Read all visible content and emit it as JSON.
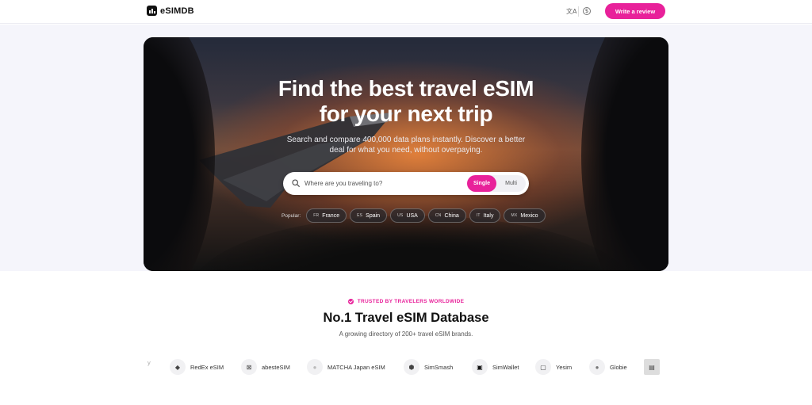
{
  "header": {
    "logo_text": "eSIMDB",
    "translate_icon": "translate-icon",
    "currency_icon": "currency-icon",
    "review_button": "Write a review"
  },
  "hero": {
    "title_line1": "Find the best travel eSIM",
    "title_line2": "for your next trip",
    "subtitle_line1": "Search and compare 400,000 data plans instantly. Discover a better",
    "subtitle_line2": "deal for what you need, without overpaying.",
    "search": {
      "placeholder": "Where are you traveling to?",
      "value": "",
      "mode_single": "Single",
      "mode_multi": "Multi",
      "active_mode": "Single"
    },
    "popular": {
      "label": "Popular:",
      "destinations": [
        {
          "code": "FR",
          "name": "France"
        },
        {
          "code": "ES",
          "name": "Spain"
        },
        {
          "code": "US",
          "name": "USA"
        },
        {
          "code": "CN",
          "name": "China"
        },
        {
          "code": "IT",
          "name": "Italy"
        },
        {
          "code": "MX",
          "name": "Mexico"
        }
      ]
    }
  },
  "trust": {
    "eyebrow": "TRUSTED BY TRAVELERS WORLDWIDE",
    "title": "No.1 Travel eSIM Database",
    "subtitle": "A growing directory of 200+ travel eSIM brands."
  },
  "brands": [
    {
      "name": "y",
      "logo": ""
    },
    {
      "name": "RedEx eSIM",
      "logo": "◆"
    },
    {
      "name": "abesteSIM",
      "logo": "⊠"
    },
    {
      "name": "MATCHA Japan eSIM",
      "logo": "●"
    },
    {
      "name": "SimSmash",
      "logo": "⬢"
    },
    {
      "name": "SimWallet",
      "logo": "▣"
    },
    {
      "name": "Yesim",
      "logo": "▢"
    },
    {
      "name": "Globie",
      "logo": "●"
    },
    {
      "name": "",
      "logo": "▤"
    }
  ],
  "colors": {
    "accent": "#e8219a",
    "band": "#f5f5fb"
  }
}
